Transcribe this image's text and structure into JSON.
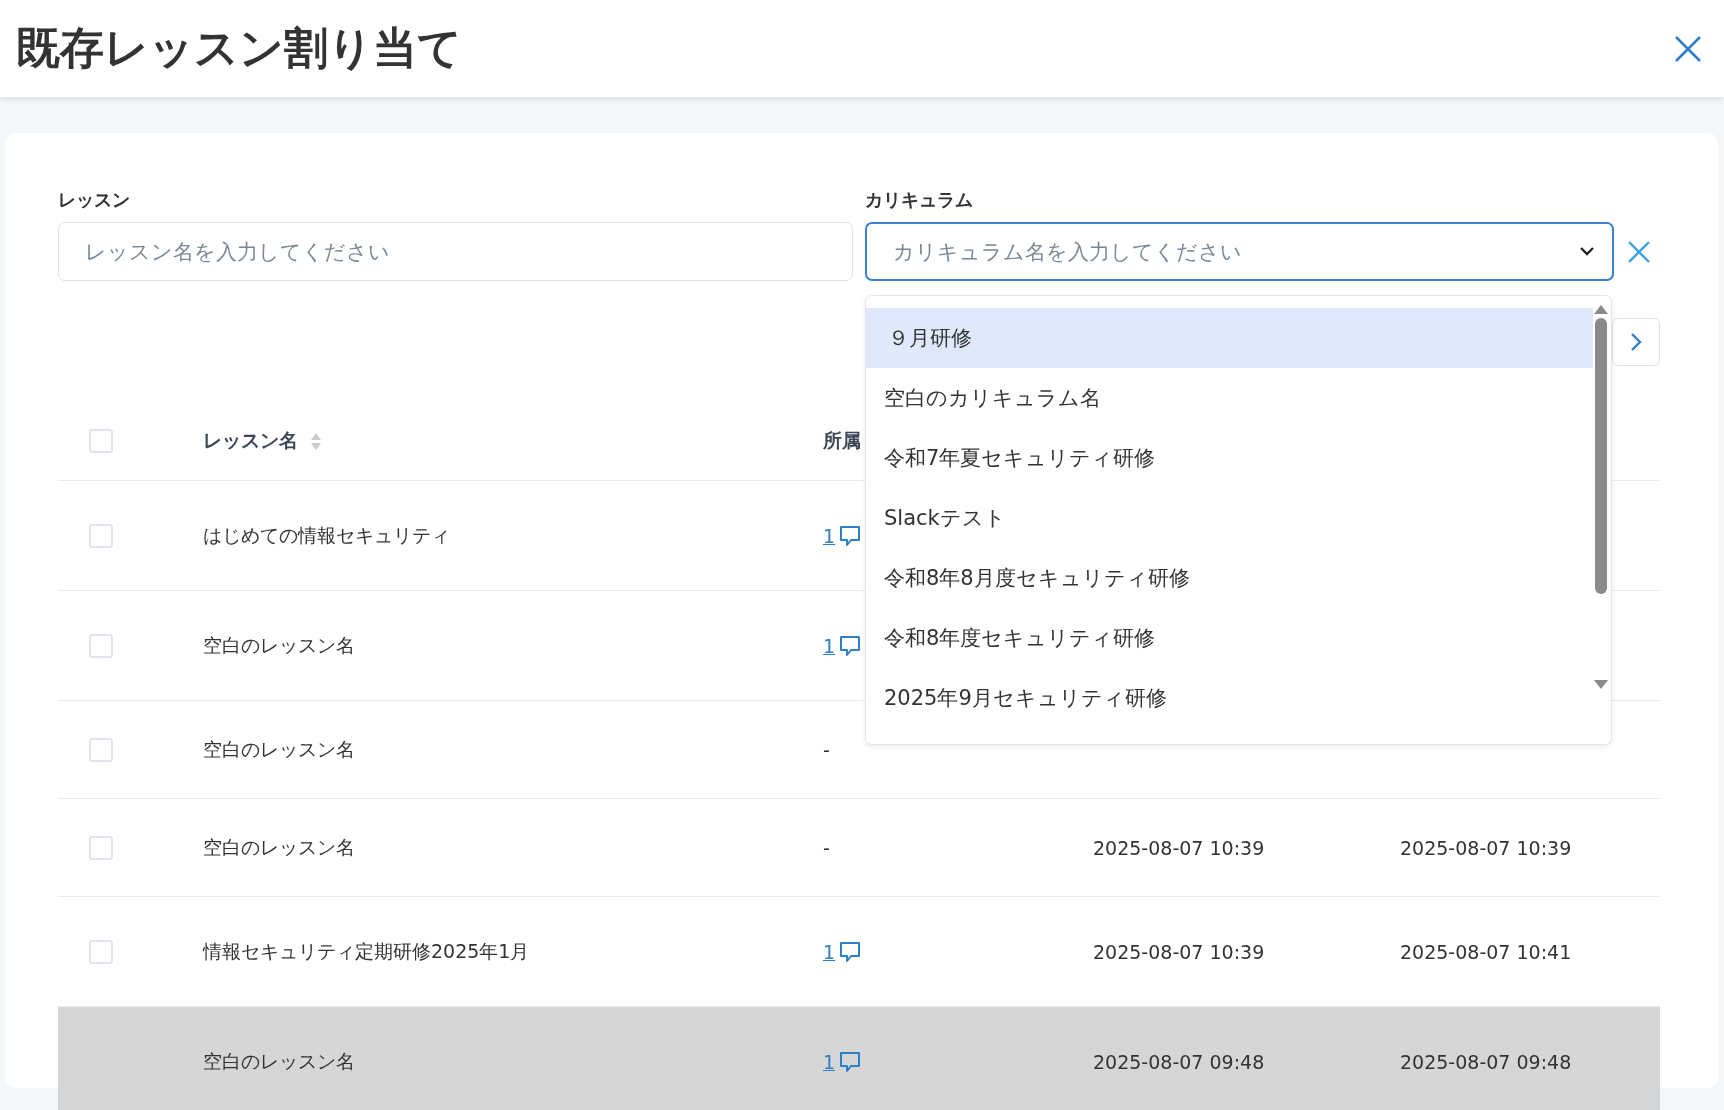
{
  "window": {
    "title": "既存レッスン割り当て"
  },
  "filters": [
    {
      "kind": "text",
      "label": "レッスン",
      "placeholder": "レッスン名を入力してください"
    },
    {
      "kind": "select",
      "label": "カリキュラム",
      "placeholder": "カリキュラム名を入力してください",
      "expanded": true,
      "clearable": true
    }
  ],
  "dropdown": {
    "options": [
      {
        "label": "９月研修",
        "selected": true
      },
      {
        "label": "空白のカリキュラム名",
        "selected": false
      },
      {
        "label": "令和7年夏セキュリティ研修",
        "selected": false
      },
      {
        "label": "Slackテスト",
        "selected": false
      },
      {
        "label": "令和8年8月度セキュリティ研修",
        "selected": false
      },
      {
        "label": "令和8年度セキュリティ研修",
        "selected": false
      },
      {
        "label": "2025年9月セキュリティ研修",
        "selected": false
      }
    ]
  },
  "table": {
    "select_all": {
      "checked": false
    },
    "columns": [
      {
        "label": "レッスン名",
        "sortable": true
      },
      {
        "label": "所属",
        "sortable": false
      }
    ],
    "rows": [
      {
        "name": "はじめての情報セキュリティ",
        "checked": false,
        "disabled": false,
        "affiliation": {
          "kind": "link",
          "text": "1"
        }
      },
      {
        "name": "空白のレッスン名",
        "checked": false,
        "disabled": false,
        "affiliation": {
          "kind": "link",
          "text": "1"
        }
      },
      {
        "name": "空白のレッスン名",
        "checked": false,
        "disabled": false,
        "affiliation": {
          "kind": "plain",
          "text": "-"
        }
      },
      {
        "name": "空白のレッスン名",
        "checked": false,
        "disabled": false,
        "affiliation": {
          "kind": "plain",
          "text": "-"
        },
        "created": "2025-08-07 10:39",
        "updated": "2025-08-07 10:39"
      },
      {
        "name": "情報セキュリティ定期研修2025年1月",
        "checked": false,
        "disabled": false,
        "affiliation": {
          "kind": "link",
          "text": "1"
        },
        "created": "2025-08-07 10:39",
        "updated": "2025-08-07 10:41"
      },
      {
        "name": "空白のレッスン名",
        "disabled": true,
        "affiliation": {
          "kind": "link",
          "text": "1"
        },
        "created": "2025-08-07 09:48",
        "updated": "2025-08-07 09:48"
      }
    ]
  }
}
